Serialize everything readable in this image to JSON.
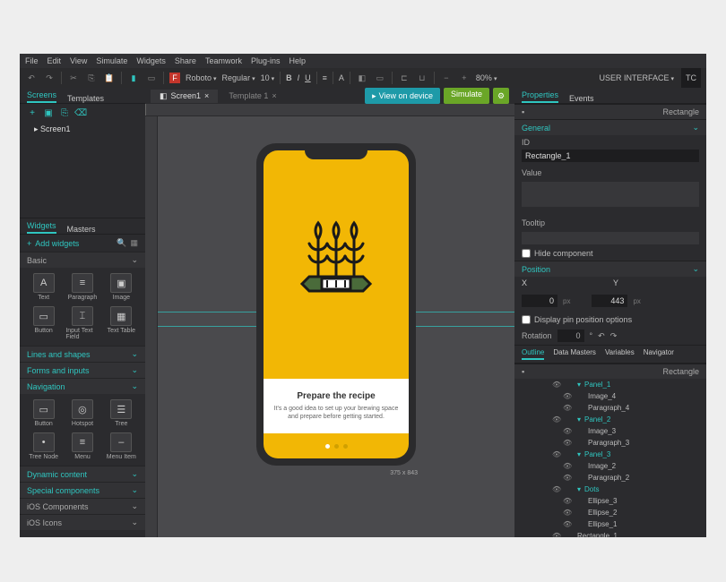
{
  "menubar": [
    "File",
    "Edit",
    "View",
    "Simulate",
    "Widgets",
    "Share",
    "Teamwork",
    "Plug-ins",
    "Help"
  ],
  "toolbar": {
    "font": "Roboto",
    "weight": "Regular",
    "size": "10",
    "zoom": "80%",
    "project": "USER INTERFACE",
    "user": "TC"
  },
  "left": {
    "tabs": {
      "screens": "Screens",
      "templates": "Templates"
    },
    "screen": "Screen1",
    "widgets_tab": "Widgets",
    "masters_tab": "Masters",
    "add_widgets": "Add widgets",
    "cat_basic": "Basic",
    "basic": [
      {
        "label": "Text",
        "icon": "A"
      },
      {
        "label": "Paragraph",
        "icon": "≡"
      },
      {
        "label": "Image",
        "icon": "▣"
      },
      {
        "label": "Button",
        "icon": "▭"
      },
      {
        "label": "Input Text Field",
        "icon": "⌶"
      },
      {
        "label": "Text Table",
        "icon": "▦"
      }
    ],
    "cat_lines": "Lines and shapes",
    "cat_forms": "Forms and inputs",
    "cat_nav": "Navigation",
    "nav": [
      {
        "label": "Button",
        "icon": "▭"
      },
      {
        "label": "Hotspot",
        "icon": "◎"
      },
      {
        "label": "Tree",
        "icon": "☰"
      },
      {
        "label": "Tree Node",
        "icon": "•"
      },
      {
        "label": "Menu",
        "icon": "≡"
      },
      {
        "label": "Menu Item",
        "icon": "–"
      }
    ],
    "cat_dynamic": "Dynamic content",
    "cat_special": "Special components",
    "cat_ios_comp": "iOS Components",
    "cat_ios_icons": "iOS Icons"
  },
  "canvas": {
    "tab1": "Screen1",
    "tab2": "Template 1",
    "view_on_device": "View on device",
    "simulate": "Simulate",
    "card_title": "Prepare the recipe",
    "card_body": "It's a good idea to set up your brewing space and prepare before getting started.",
    "dims": "375 x 843"
  },
  "right": {
    "tab_props": "Properties",
    "tab_events": "Events",
    "rectangle": "Rectangle",
    "general": "General",
    "id_label": "ID",
    "id_value": "Rectangle_1",
    "value_label": "Value",
    "tooltip_label": "Tooltip",
    "hide": "Hide component",
    "position": "Position",
    "x_label": "X",
    "y_label": "Y",
    "x_val": "0",
    "y_val": "443",
    "px": "px",
    "display_pin": "Display pin position options",
    "rotation": "Rotation",
    "rot_val": "0",
    "outline_tabs": [
      "Outline",
      "Data Masters",
      "Variables",
      "Navigator"
    ],
    "outline_root": "Rectangle",
    "tree": [
      {
        "d": 2,
        "t": "Panel_1",
        "hl": true,
        "caret": true
      },
      {
        "d": 3,
        "t": "Image_4"
      },
      {
        "d": 3,
        "t": "Paragraph_4"
      },
      {
        "d": 2,
        "t": "Panel_2",
        "hl": true,
        "caret": true
      },
      {
        "d": 3,
        "t": "Image_3"
      },
      {
        "d": 3,
        "t": "Paragraph_3"
      },
      {
        "d": 2,
        "t": "Panel_3",
        "hl": true,
        "caret": true
      },
      {
        "d": 3,
        "t": "Image_2"
      },
      {
        "d": 3,
        "t": "Paragraph_2"
      },
      {
        "d": 2,
        "t": "Dots",
        "hl": true,
        "caret": true
      },
      {
        "d": 3,
        "t": "Ellipse_3"
      },
      {
        "d": 3,
        "t": "Ellipse_2"
      },
      {
        "d": 3,
        "t": "Ellipse_1"
      },
      {
        "d": 2,
        "t": "Rectangle_1"
      }
    ]
  }
}
